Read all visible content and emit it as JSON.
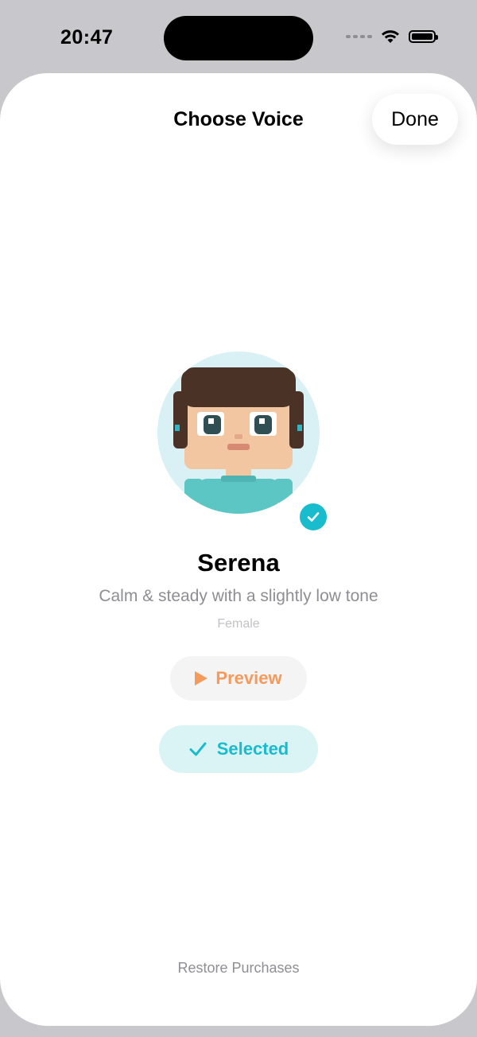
{
  "status_bar": {
    "time": "20:47",
    "icons": [
      "cellular-signal-icon",
      "wifi-icon",
      "battery-icon"
    ]
  },
  "sheet": {
    "title": "Choose Voice",
    "done_label": "Done"
  },
  "voice": {
    "name": "Serena",
    "description": "Calm & steady with a slightly low tone",
    "gender": "Female",
    "avatar_icon": "pixel-character-avatar",
    "selected_badge_icon": "checkmark-circle-icon"
  },
  "actions": {
    "preview_label": "Preview",
    "preview_icon": "play-icon",
    "selected_label": "Selected",
    "selected_icon": "checkmark-icon"
  },
  "footer": {
    "restore_label": "Restore Purchases"
  },
  "colors": {
    "accent_teal": "#18bccc",
    "accent_orange": "#f59a5b",
    "avatar_bg": "#d9f1f4",
    "selected_bg": "#daf4f6",
    "secondary_text": "#8e8e93"
  }
}
